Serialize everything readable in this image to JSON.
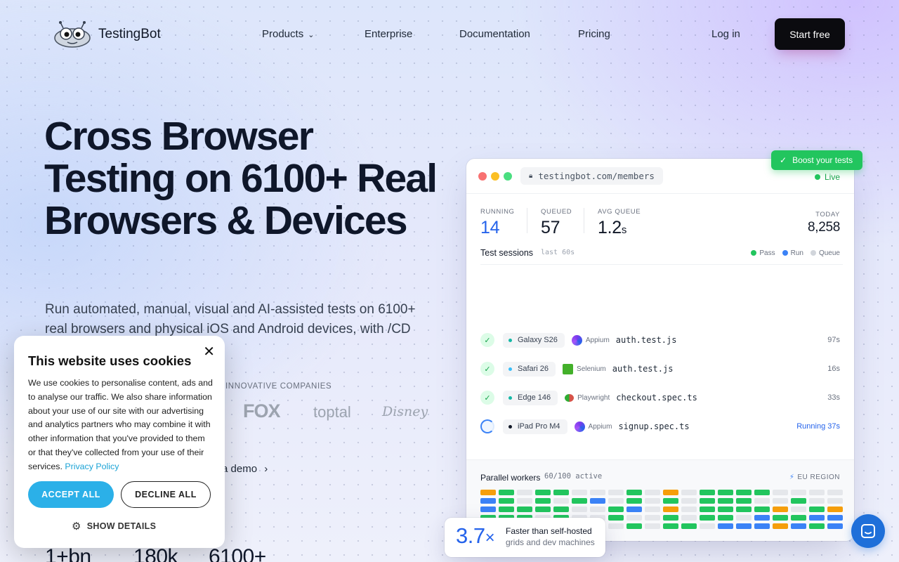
{
  "nav": {
    "logo_text": "TestingBot",
    "products": "Products",
    "enterprise": "Enterprise",
    "documentation": "Documentation",
    "pricing": "Pricing",
    "login": "Log in",
    "start": "Start free"
  },
  "hero": {
    "title": "Cross Browser Testing on 6100+ Real Browsers & Devices",
    "subtitle": "Run automated, manual, visual and AI-assisted tests on 6100+ real browsers and physical iOS and Android devices, with /CD integrations.",
    "trusted": "INNOVATIVE COMPANIES",
    "brands": [
      "FOX",
      "toptal",
      "Disney"
    ],
    "demo": "a demo",
    "stats": [
      "1+bn",
      "180k",
      "6100+"
    ]
  },
  "dashboard": {
    "url": "testingbot.com/members",
    "live": "Live",
    "metrics": [
      {
        "label": "RUNNING",
        "value": "14"
      },
      {
        "label": "QUEUED",
        "value": "57"
      },
      {
        "label": "AVG QUEUE",
        "value": "1.2",
        "unit": "s"
      },
      {
        "label": "TODAY",
        "value": "8,258"
      }
    ],
    "sessions_title": "Test sessions",
    "sessions_sub": "last 60s",
    "legend": [
      "Pass",
      "Run",
      "Queue"
    ],
    "rows": [
      {
        "device": "Galaxy S26",
        "dot": "#14b8a6",
        "framework": "Appium",
        "file": "auth.test.js",
        "duration": "97s",
        "status": "pass"
      },
      {
        "device": "Safari 26",
        "dot": "#38bdf8",
        "framework": "Selenium",
        "file": "auth.test.js",
        "duration": "16s",
        "status": "pass"
      },
      {
        "device": "Edge 146",
        "dot": "#14b8a6",
        "framework": "Playwright",
        "file": "checkout.spec.ts",
        "duration": "33s",
        "status": "pass"
      },
      {
        "device": "iPad Pro M4",
        "dot": "#111827",
        "framework": "Appium",
        "file": "signup.spec.ts",
        "duration": "Running 37s",
        "status": "run"
      }
    ],
    "workers_title": "Parallel workers",
    "workers_count": "60/100 active",
    "region": "EU REGION",
    "worker_grid": [
      "ogxggxxxgxoxggggxxxx",
      "bgxgxgbxgxgxgggxxgxx",
      "bggggxxgbxoxggggoxgo",
      "gggxgxxgxxgxggxbggbb",
      "ggxgggxxgxggxbbbobgb"
    ]
  },
  "badges": {
    "boost": "Boost your tests",
    "speed_value": "3.7",
    "speed_unit": "×",
    "speed_line1": "Faster than self-hosted",
    "speed_line2": "grids and dev machines"
  },
  "cookie": {
    "title": "This website uses cookies",
    "body": "We use cookies to personalise content, ads and to analyse our traffic. We also share information about your use of our site with our advertising and analytics partners who may combine it with other information that you've provided to them or that they've collected from your use of their services. ",
    "privacy": "Privacy Policy",
    "accept": "ACCEPT ALL",
    "decline": "DECLINE ALL",
    "details": "SHOW DETAILS"
  },
  "colors": {
    "pass": "#22c55e",
    "run": "#3b82f6",
    "queue": "#d1d5db",
    "warn": "#f59e0b",
    "accent": "#2563eb",
    "cookie_accent": "#2bb0e8"
  }
}
